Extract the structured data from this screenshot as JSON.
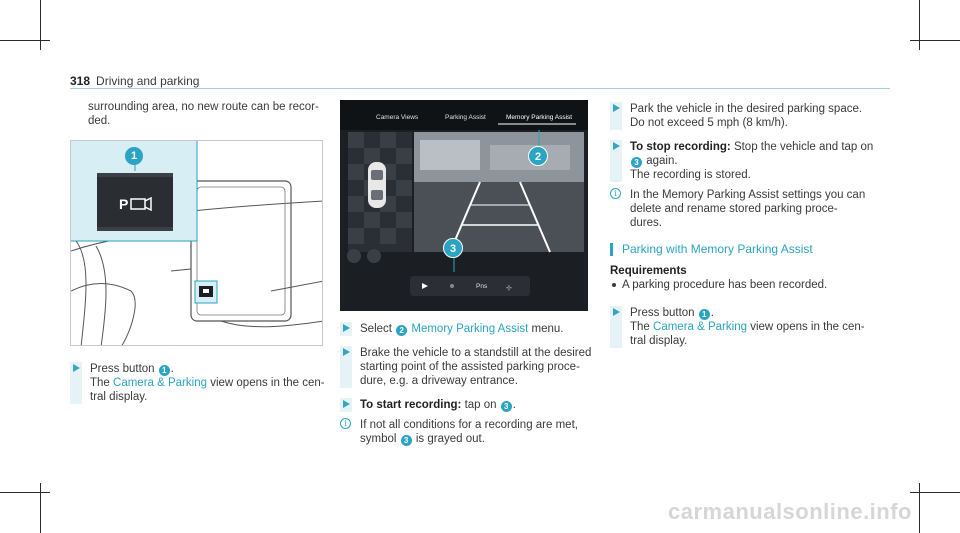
{
  "header": {
    "page_number": "318",
    "section": "Driving and parking"
  },
  "col1": {
    "intro": "surrounding area, no new route can be recor-\nded.",
    "step1": {
      "pre": "Press button",
      "num": "1",
      "post": ".",
      "line2_pre": "The",
      "link": "Camera & Parking",
      "line2_post": "view opens in the cen-",
      "line3": "tral display."
    },
    "figure": {
      "callout": "1"
    }
  },
  "col2": {
    "screen": {
      "tabs": [
        "Camera Views",
        "Parking Assist",
        "Memory Parking Assist"
      ],
      "callouts": [
        "2",
        "3"
      ],
      "bottom_label": "Pns"
    },
    "step1": {
      "pre": "Select",
      "num": "2",
      "link": "Memory Parking Assist",
      "post": "menu."
    },
    "step2": {
      "line1": "Brake the vehicle to a standstill at the desired",
      "line2": "starting point of the assisted parking proce-",
      "line3": "dure, e.g. a driveway entrance."
    },
    "step3": {
      "label": "To start recording:",
      "text": "tap on",
      "num": "3",
      "post": "."
    },
    "info": {
      "line1": "If not all conditions for a recording are met,",
      "line2_pre": "symbol",
      "num": "3",
      "line2_post": "is grayed out."
    }
  },
  "col3": {
    "step1": {
      "line1": "Park the vehicle in the desired parking space.",
      "line2": "Do not exceed 5 mph (8 km/h)."
    },
    "step2": {
      "label": "To stop recording:",
      "text": "Stop the vehicle and tap on",
      "num": "3",
      "post": "again.",
      "line3": "The recording is stored."
    },
    "info": {
      "line1": "In the Memory Parking Assist settings you can",
      "line2": "delete and rename stored parking proce-",
      "line3": "dures."
    },
    "section_title": "Parking with Memory Parking Assist",
    "requirements_label": "Requirements",
    "requirement": "A parking procedure has been recorded.",
    "step3": {
      "pre": "Press button",
      "num": "1",
      "post": ".",
      "line2_pre": "The",
      "link": "Camera & Parking",
      "line2_post": "view opens in the cen-",
      "line3": "tral display."
    }
  },
  "watermark": "carmanualsonline.info",
  "colors": {
    "accent": "#2ba3c2",
    "rule": "#9fcfd9",
    "screen_bg": "#1b1f24"
  }
}
